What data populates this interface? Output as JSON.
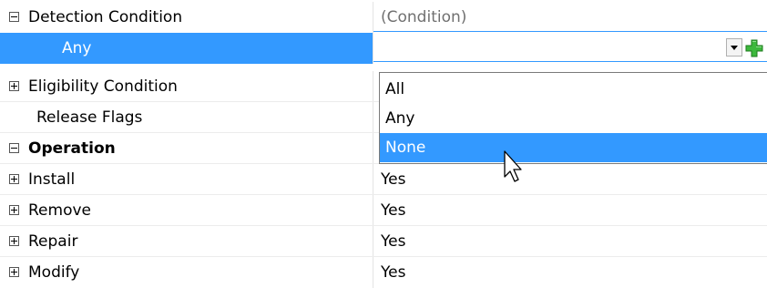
{
  "grid": {
    "rows": [
      {
        "name": "Detection Condition",
        "value": "(Condition)"
      },
      {
        "name": "Any",
        "value": ""
      },
      {
        "name": "Eligibility Condition",
        "value": ""
      },
      {
        "name": "Release Flags",
        "value": ""
      },
      {
        "name": "Operation",
        "value": ""
      },
      {
        "name": "Install",
        "value": "Yes"
      },
      {
        "name": "Remove",
        "value": "Yes"
      },
      {
        "name": "Repair",
        "value": "Yes"
      },
      {
        "name": "Modify",
        "value": "Yes"
      }
    ]
  },
  "dropdown": {
    "options": [
      "All",
      "Any",
      "None"
    ],
    "highlighted": "None"
  },
  "icons": {
    "expand": "plus-box-icon",
    "collapse": "minus-box-icon",
    "dropdown": "dropdown-arrow-icon",
    "add": "green-plus-icon",
    "cursor": "mouse-pointer-icon"
  },
  "colors": {
    "selection": "#3399ff",
    "add_icon": "#2ea82e"
  }
}
